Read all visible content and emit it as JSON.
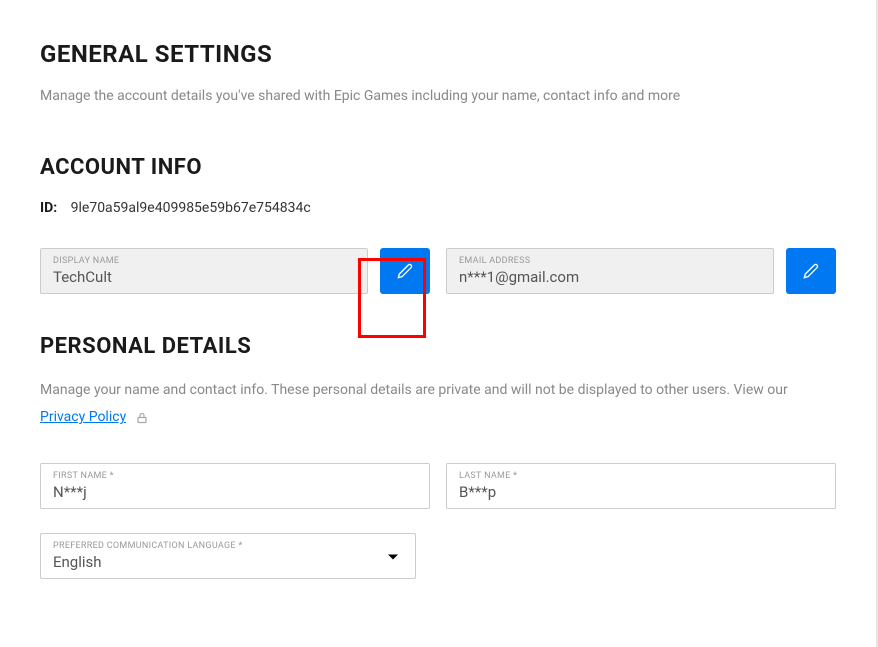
{
  "general": {
    "title": "GENERAL SETTINGS",
    "subtitle": "Manage the account details you've shared with Epic Games including your name, contact info and more"
  },
  "account": {
    "title": "ACCOUNT INFO",
    "id_label": "ID:",
    "id_value": "9le70a59al9e409985e59b67e754834c",
    "display_name": {
      "label": "DISPLAY NAME",
      "value": "TechCult"
    },
    "email": {
      "label": "EMAIL ADDRESS",
      "value": "n***1@gmail.com"
    }
  },
  "personal": {
    "title": "PERSONAL DETAILS",
    "info": "Manage your name and contact info. These personal details are private and will not be displayed to other users. View our",
    "privacy_link": "Privacy Policy",
    "first_name": {
      "label": "FIRST NAME *",
      "value": "N***j"
    },
    "last_name": {
      "label": "LAST NAME *",
      "value": "B***p"
    },
    "language": {
      "label": "PREFERRED COMMUNICATION LANGUAGE *",
      "value": "English"
    }
  }
}
